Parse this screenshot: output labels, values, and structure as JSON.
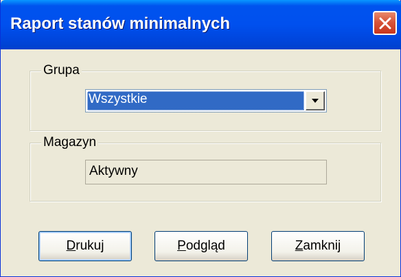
{
  "window": {
    "title": "Raport stanów minimalnych"
  },
  "groups": {
    "grupa": {
      "label": "Grupa",
      "selected_value": "Wszystkie"
    },
    "magazyn": {
      "label": "Magazyn",
      "value": "Aktywny"
    }
  },
  "buttons": {
    "print": {
      "accel": "D",
      "rest": "rukuj"
    },
    "preview": {
      "accel": "P",
      "rest": "odgląd"
    },
    "close": {
      "accel": "Z",
      "rest": "amknij"
    }
  },
  "colors": {
    "title_bar": "#0050ee",
    "dialog_bg": "#ece9d8",
    "selection": "#316ac5",
    "close_button": "#d8553a"
  },
  "icons": {
    "close": "close-icon",
    "dropdown": "chevron-down-icon"
  }
}
